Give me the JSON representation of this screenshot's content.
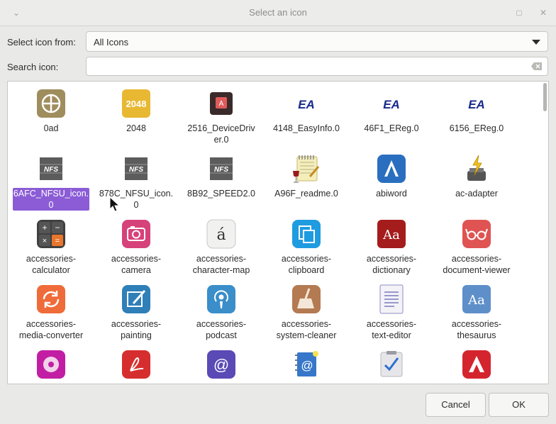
{
  "window": {
    "title": "Select an icon",
    "collapse_glyph": "⌄",
    "maximize_glyph": "□",
    "close_glyph": "✕"
  },
  "form": {
    "select_label": "Select icon from:",
    "select_value": "All Icons",
    "search_label": "Search icon:",
    "search_value": ""
  },
  "icons": [
    {
      "label": "0ad",
      "icon": "crosshair-icon"
    },
    {
      "label": "2048",
      "icon": "2048-icon"
    },
    {
      "label": "2516_DeviceDriver.0",
      "icon": "device-driver-icon"
    },
    {
      "label": "4148_EasyInfo.0",
      "icon": "ea-logo-icon"
    },
    {
      "label": "46F1_EReg.0",
      "icon": "ea-logo-icon"
    },
    {
      "label": "6156_EReg.0",
      "icon": "ea-logo-icon"
    },
    {
      "label": "6AFC_NFSU_icon.0",
      "icon": "nfs-icon"
    },
    {
      "label": "878C_NFSU_icon.0",
      "icon": "nfs-icon"
    },
    {
      "label": "8B92_SPEED2.0",
      "icon": "nfs-icon"
    },
    {
      "label": "A96F_readme.0",
      "icon": "notepad-wine-icon"
    },
    {
      "label": "abiword",
      "icon": "abiword-icon"
    },
    {
      "label": "ac-adapter",
      "icon": "ac-adapter-icon"
    },
    {
      "label": "accessories-calculator",
      "icon": "calculator-icon"
    },
    {
      "label": "accessories-camera",
      "icon": "camera-icon"
    },
    {
      "label": "accessories-character-map",
      "icon": "character-map-icon"
    },
    {
      "label": "accessories-clipboard",
      "icon": "clipboard-icon"
    },
    {
      "label": "accessories-dictionary",
      "icon": "dictionary-icon"
    },
    {
      "label": "accessories-document-viewer",
      "icon": "document-viewer-icon"
    },
    {
      "label": "accessories-media-converter",
      "icon": "media-converter-icon"
    },
    {
      "label": "accessories-painting",
      "icon": "painting-icon"
    },
    {
      "label": "accessories-podcast",
      "icon": "podcast-icon"
    },
    {
      "label": "accessories-system-cleaner",
      "icon": "system-cleaner-icon"
    },
    {
      "label": "accessories-text-editor",
      "icon": "text-editor-icon"
    },
    {
      "label": "accessories-thesaurus",
      "icon": "thesaurus-icon"
    },
    {
      "label": "",
      "icon": "disc-icon"
    },
    {
      "label": "",
      "icon": "pdf-icon"
    },
    {
      "label": "",
      "icon": "email-icon"
    },
    {
      "label": "",
      "icon": "address-book-icon"
    },
    {
      "label": "",
      "icon": "task-checklist-icon"
    },
    {
      "label": "",
      "icon": "adobe-air-icon"
    }
  ],
  "selected_index": 6,
  "buttons": {
    "cancel": "Cancel",
    "ok": "OK"
  },
  "colors": {
    "selection": "#8b5cd6"
  }
}
